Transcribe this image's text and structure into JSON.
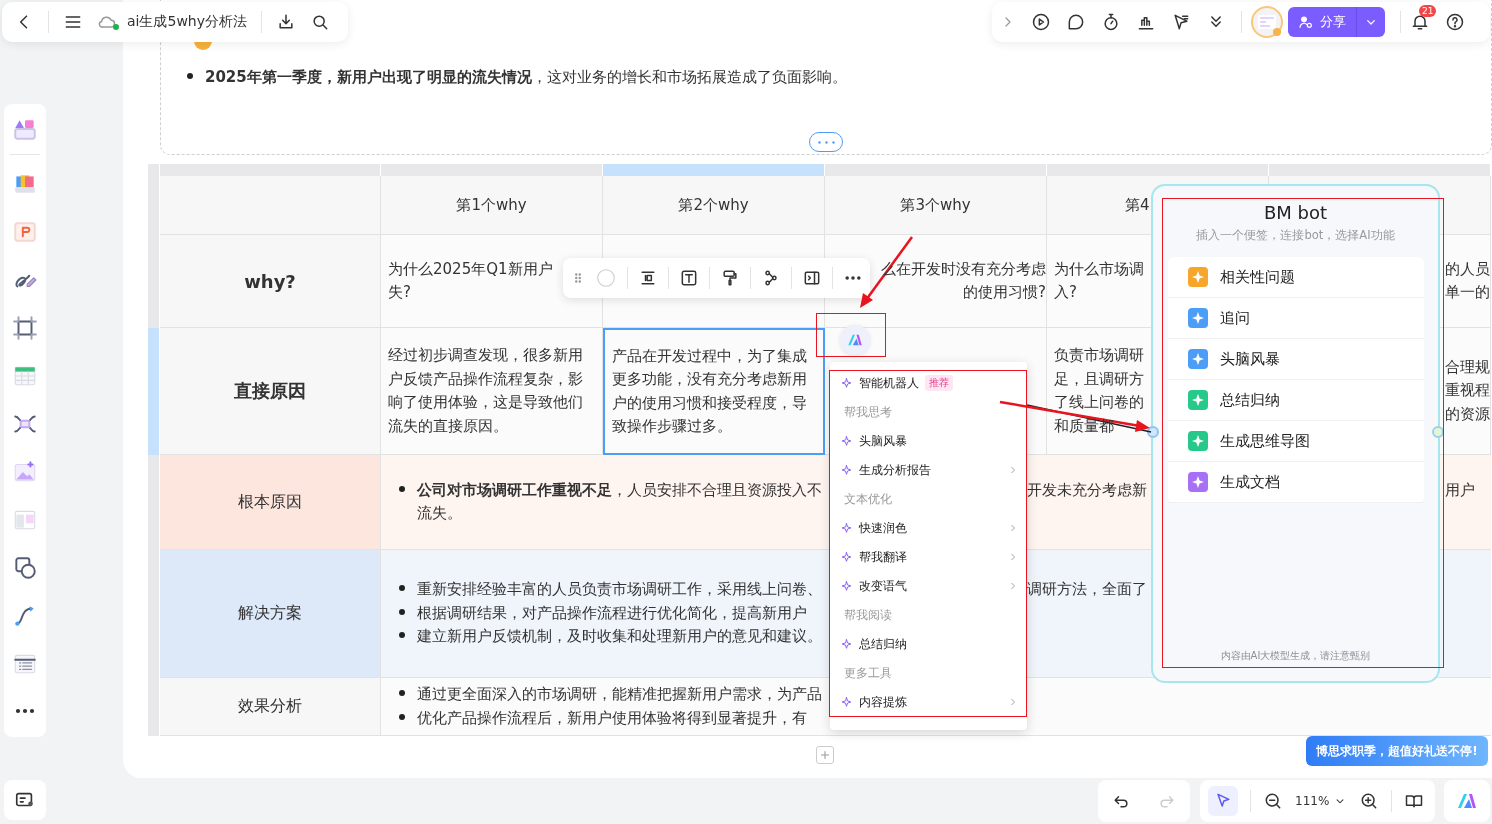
{
  "top_bar": {
    "title": "ai生成5why分析法",
    "synced": true
  },
  "top_actions": {
    "share": "分享",
    "notifications": "21"
  },
  "document": {
    "bullet": "**2025年第一季度，新用户出现了明显的流失情况**，这对业务的增长和市场拓展造成了负面影响。"
  },
  "table": {
    "columns": [
      {
        "selected": false
      },
      {
        "label": "第1个why",
        "selected": false
      },
      {
        "label": "第2个why",
        "selected": true
      },
      {
        "label": "第3个why",
        "selected": false
      },
      {
        "label": "第4",
        "selected": false
      },
      {
        "selected": false
      }
    ],
    "rows": [
      {
        "header": "why?",
        "strong": true,
        "color": "#f7f7f7",
        "selected": false,
        "cells": [
          {
            "lines": [
              "为什么2025年Q1新用户",
              "失?"
            ],
            "selected": false
          },
          {
            "selected": false
          },
          {
            "lines": [
              "么在开发时没有充分考虑",
              "的使用习惯?"
            ],
            "selected": false
          },
          {
            "lines": [
              "为什么市场调",
              "入?"
            ],
            "selected": false
          },
          {
            "lines": [
              "的人员",
              "单一的"
            ],
            "selected": false
          }
        ]
      },
      {
        "header": "直接原因",
        "strong": true,
        "color": "#f7f7f7",
        "selected": true,
        "cells": [
          {
            "lines": [
              "经过初步调查发现，很多新用户反馈产品操作流程复杂，影响了使用体验，这是导致他们流失的直接原因。"
            ],
            "selected": false
          },
          {
            "lines": [
              "产品在开发过程中，为了集成更多功能，没有充分考虑新用户的使用习惯和接受程度，导致操作步骤过多。"
            ],
            "selected": true
          },
          {
            "selected": false
          },
          {
            "lines": [
              "负责市场调研",
              "足，且调研方",
              "了线上问卷的",
              "和质量都"
            ],
            "selected": false
          },
          {
            "lines": [
              "合理规",
              "重视程",
              "的资源"
            ],
            "selected": false
          }
        ]
      },
      {
        "header": "根本原因",
        "strong": false,
        "color": "#fde6de",
        "selected": false,
        "content_left": [
          [
            "**公司对市场调研工作重视不足**，人员安排不合理且资源投入不",
            "流失。"
          ]
        ],
        "content_middle": "开发未充分考虑新",
        "content_right": "用户"
      },
      {
        "header": "解决方案",
        "strong": false,
        "color": "#dde9f9",
        "selected": false,
        "content_left": [
          [
            "重新安排经验丰富的人员负责市场调研工作，采用线上问卷、"
          ],
          [
            "根据调研结果，对产品操作流程进行优化简化，提高新用户"
          ],
          [
            "建立新用户反馈机制，及时收集和处理新用户的意见和建议。"
          ]
        ],
        "content_middle": "调研方法，全面了"
      },
      {
        "header": "效果分析",
        "strong": false,
        "color": "#f7f7f7",
        "selected": false,
        "content_left": [
          [
            "通过更全面深入的市场调研，能精准把握新用户需求，为产品"
          ],
          [
            "优化产品操作流程后，新用户使用体验将得到显著提升，有"
          ]
        ]
      }
    ]
  },
  "ai_menu": {
    "items": [
      {
        "kind": "item",
        "label": "智能机器人",
        "badge": "推荐",
        "submenu": false
      },
      {
        "kind": "section",
        "label": "帮我思考"
      },
      {
        "kind": "item",
        "label": "头脑风暴",
        "submenu": false
      },
      {
        "kind": "item",
        "label": "生成分析报告",
        "submenu": true
      },
      {
        "kind": "section",
        "label": "文本优化"
      },
      {
        "kind": "item",
        "label": "快速润色",
        "submenu": true
      },
      {
        "kind": "item",
        "label": "帮我翻译",
        "submenu": true
      },
      {
        "kind": "item",
        "label": "改变语气",
        "submenu": true
      },
      {
        "kind": "section",
        "label": "帮我阅读"
      },
      {
        "kind": "item",
        "label": "总结归纳",
        "submenu": false
      },
      {
        "kind": "section",
        "label": "更多工具"
      },
      {
        "kind": "item",
        "label": "内容提炼",
        "submenu": true
      }
    ]
  },
  "bot_panel": {
    "title": "BM bot",
    "subtitle": "插入一个便签，连接bot，选择AI功能",
    "items": [
      {
        "label": "相关性问题",
        "color": "#f7a62b"
      },
      {
        "label": "追问",
        "color": "#4c9df8"
      },
      {
        "label": "头脑风暴",
        "color": "#4c9df8"
      },
      {
        "label": "总结归纳",
        "color": "#27c98b"
      },
      {
        "label": "生成思维导图",
        "color": "#27c98b"
      },
      {
        "label": "生成文档",
        "color": "#a770f5"
      }
    ],
    "footnote": "内容由AI大模型生成，请注意甄别"
  },
  "bottom_bar": {
    "undo_enabled": true,
    "redo_enabled": false,
    "select_active": true,
    "zoom": "111%"
  },
  "promo": "博思求职季，超值好礼送不停!"
}
